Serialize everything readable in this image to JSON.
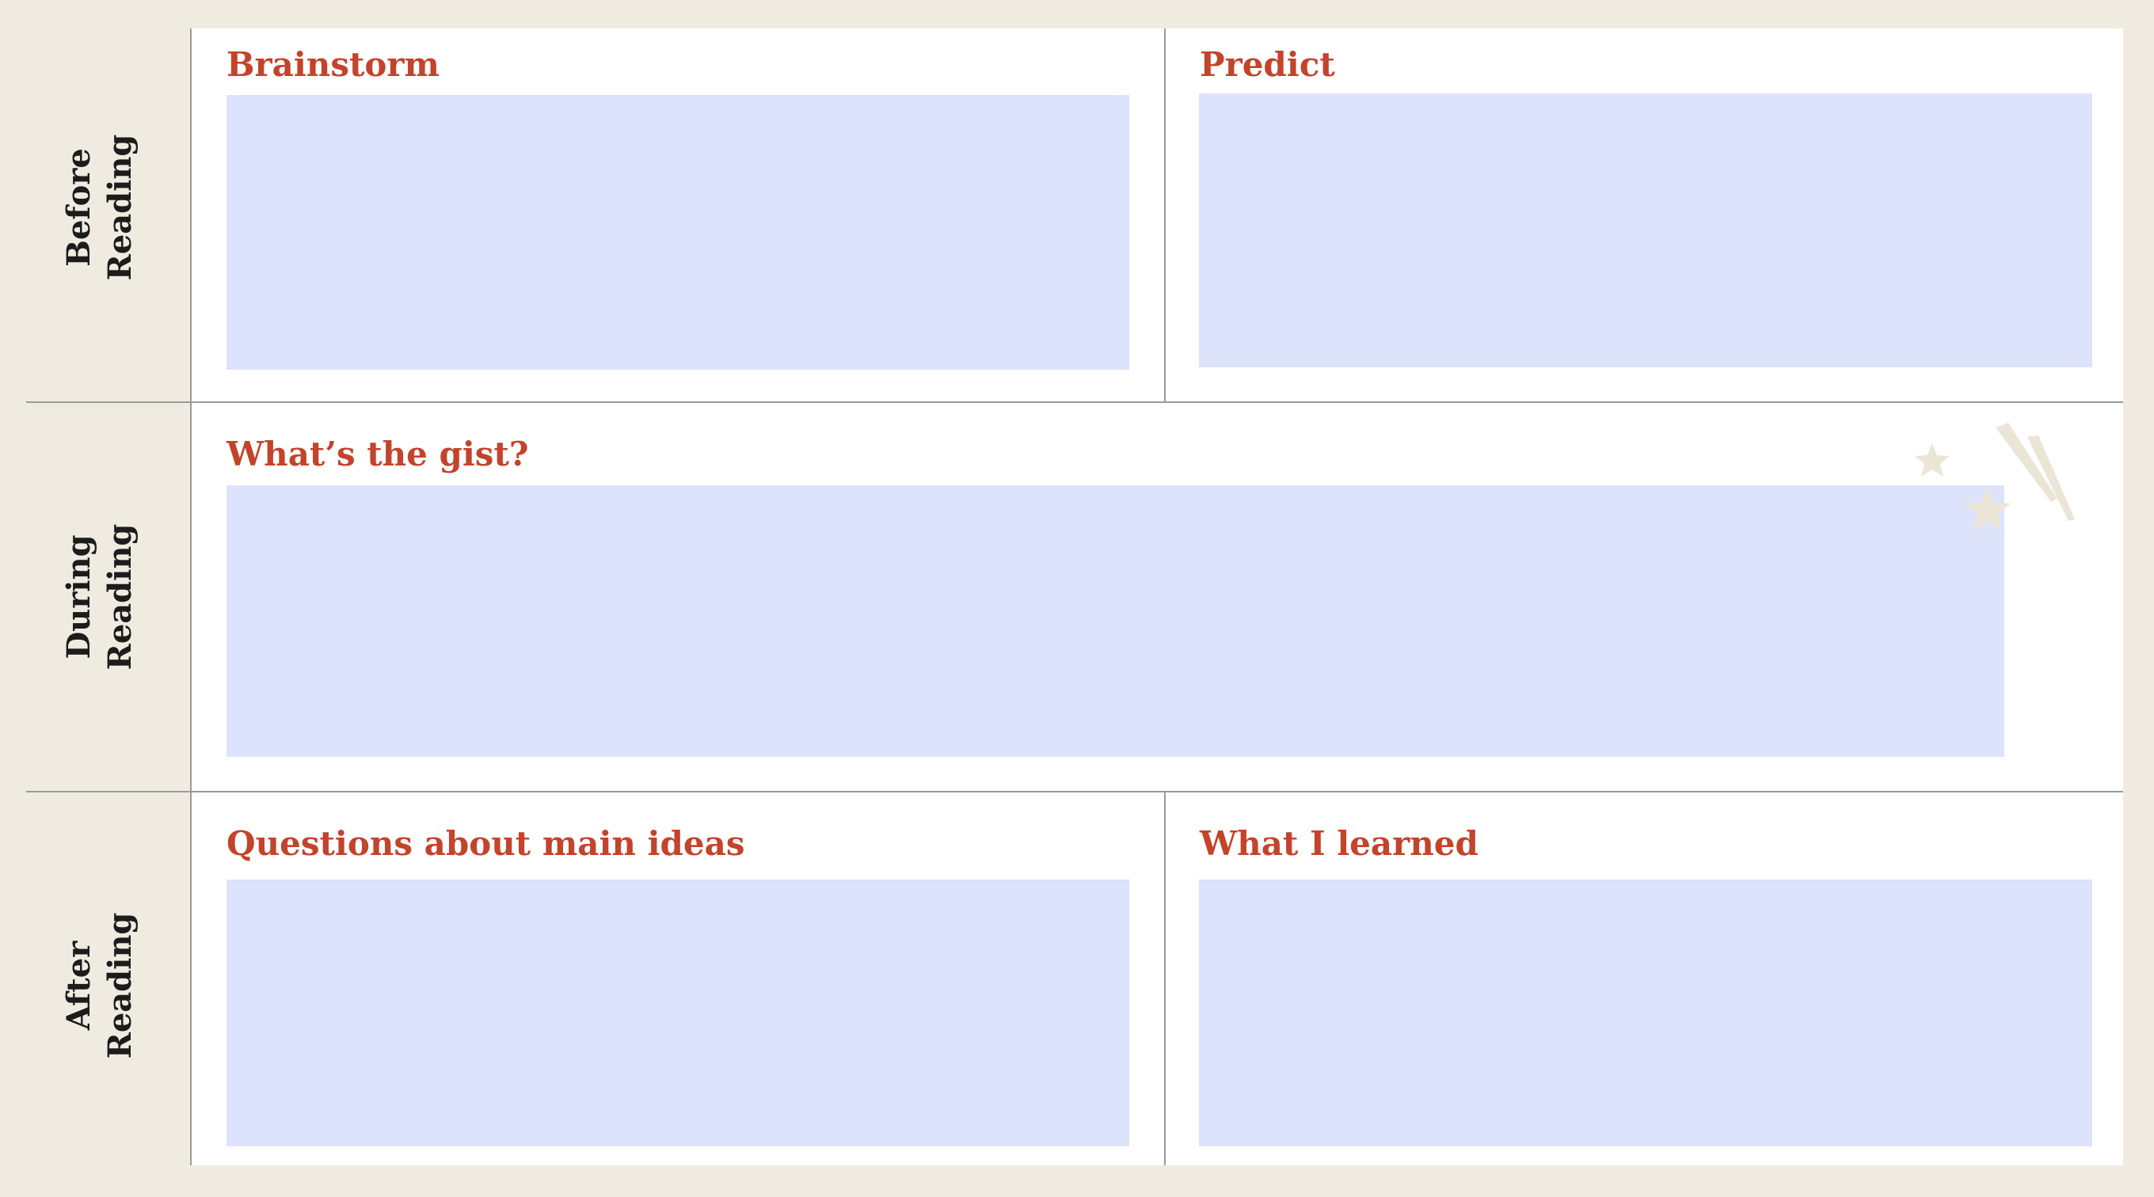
{
  "rows": {
    "before": {
      "line1": "Before",
      "line2": "Reading"
    },
    "during": {
      "line1": "During",
      "line2": "Reading"
    },
    "after": {
      "line1": "After",
      "line2": "Reading"
    }
  },
  "sections": {
    "brainstorm": {
      "heading": "Brainstorm",
      "value": ""
    },
    "predict": {
      "heading": "Predict",
      "value": ""
    },
    "gist": {
      "heading": "What’s the gist?",
      "value": ""
    },
    "questions": {
      "heading": "Questions about main ideas",
      "value": ""
    },
    "learned": {
      "heading": "What I learned",
      "value": ""
    }
  },
  "colors": {
    "background": "#f0ebe0",
    "sheet": "#ffffff",
    "heading": "#c4432b",
    "input_fill": "#dde3fa",
    "grid_line": "#9a9a9a",
    "decoration": "#ebe5d6"
  },
  "decoration": {
    "icon": "shooting-stars-icon"
  }
}
